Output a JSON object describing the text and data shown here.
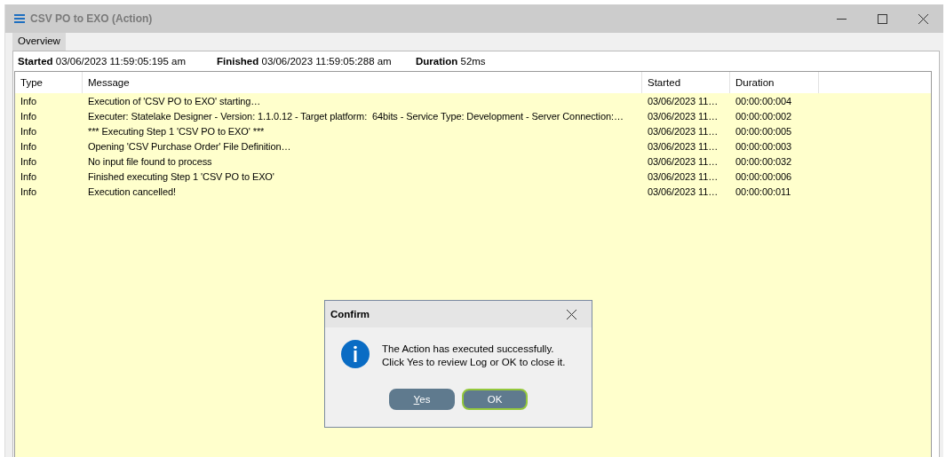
{
  "window": {
    "title": "CSV PO to EXO (Action)"
  },
  "tabs": [
    {
      "label": "Overview",
      "selected": true
    }
  ],
  "summary": [
    {
      "label": "Started",
      "value": "03/06/2023 11:59:05:195 am"
    },
    {
      "label": "Finished",
      "value": "03/06/2023 11:59:05:288 am"
    },
    {
      "label": "Duration",
      "value": "52ms"
    }
  ],
  "table": {
    "columns": [
      "Type",
      "Message",
      "Started",
      "Duration"
    ],
    "rows": [
      [
        "Info",
        "Execution of 'CSV PO to EXO' starting…",
        "03/06/2023 11…",
        "00:00:00:004"
      ],
      [
        "Info",
        "Executer: Statelake Designer - Version: 1.1.0.12 - Target platform:  64bits - Service Type: Development - Server Connection:…",
        "03/06/2023 11…",
        "00:00:00:002"
      ],
      [
        "Info",
        "*** Executing Step 1 'CSV PO to EXO' ***",
        "03/06/2023 11…",
        "00:00:00:005"
      ],
      [
        "Info",
        "Opening 'CSV Purchase Order' File Definition…",
        "03/06/2023 11…",
        "00:00:00:003"
      ],
      [
        "Info",
        "No input file found to process",
        "03/06/2023 11…",
        "00:00:00:032"
      ],
      [
        "Info",
        "Finished executing Step 1 'CSV PO to EXO'",
        "03/06/2023 11…",
        "00:00:00:006"
      ],
      [
        "Info",
        "Execution cancelled!",
        "03/06/2023 11…",
        "00:00:00:011"
      ]
    ]
  },
  "dialog": {
    "title": "Confirm",
    "message": [
      "The Action has executed successfully.",
      "Click Yes to review Log or OK to close it."
    ],
    "buttons": [
      {
        "label": "Yes",
        "default": false,
        "mnemonic": true
      },
      {
        "label": "OK",
        "default": true,
        "mnemonic": false
      }
    ]
  }
}
